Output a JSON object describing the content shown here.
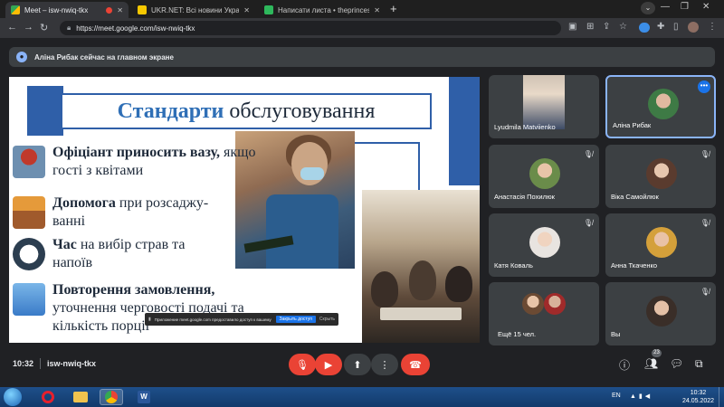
{
  "browser": {
    "tabs": [
      {
        "title": "Meet – isw-nwiq-tkx"
      },
      {
        "title": "UKR.NET: Всі новини України, о"
      },
      {
        "title": "Написати листа • theprincess@"
      }
    ],
    "url": "https://meet.google.com/isw-nwiq-tkx"
  },
  "meet": {
    "presenting_text": "Аліна Рибак сейчас на главном экране",
    "slide": {
      "title_highlight": "Стандарти",
      "title_rest": "обслуговування",
      "items": [
        {
          "bold": "Офіціант",
          "bold2": "приносить вазу,",
          "text": "якщо гості з квітами"
        },
        {
          "bold": "Допомога",
          "text": "при розсаджу-ванні"
        },
        {
          "bold": "Час",
          "text": "на вибір страв та напоїв"
        },
        {
          "bold": "Повторення замовлення,",
          "text": "уточнення черговості подачі та кількість порції"
        }
      ],
      "share_notice": {
        "message": "Приложение meet.google.com предоставило доступ к вашему экрану.",
        "stop": "Закрыть доступ",
        "hide": "Скрыть"
      }
    },
    "participants": [
      {
        "name": "Lyudmila Matviienko",
        "muted": false
      },
      {
        "name": "Аліна Рибак",
        "muted": false
      },
      {
        "name": "Анастасія Похилюк",
        "muted": true
      },
      {
        "name": "Віка Самойлюк",
        "muted": true
      },
      {
        "name": "Катя Коваль",
        "muted": true
      },
      {
        "name": "Анна Ткаченко",
        "muted": true
      },
      {
        "name": "Ещё 15 чел.",
        "muted": false
      },
      {
        "name": "Вы",
        "muted": true
      }
    ],
    "controls": {
      "time": "10:32",
      "meeting_code": "isw-nwiq-tkx",
      "people_count": "23"
    }
  },
  "taskbar": {
    "lang": "EN",
    "time": "10:32",
    "date": "24.05.2022"
  },
  "colors": {
    "meet_bg": "#202124",
    "tile_bg": "#3c4043",
    "red": "#ea4335",
    "slide_blue": "#2f5fa8",
    "active_border": "#8ab4f8"
  }
}
